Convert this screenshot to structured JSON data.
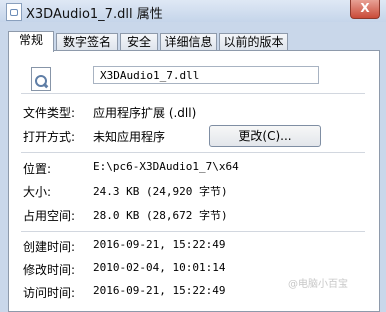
{
  "window": {
    "title": "X3DAudio1_7.dll 属性",
    "close_label": "X"
  },
  "tabs": [
    {
      "label": "常规"
    },
    {
      "label": "数字签名"
    },
    {
      "label": "安全"
    },
    {
      "label": "详细信息"
    },
    {
      "label": "以前的版本"
    }
  ],
  "file": {
    "name": "X3DAudio1_7.dll"
  },
  "props": {
    "type_label": "文件类型:",
    "type_value": "应用程序扩展 (.dll)",
    "open_label": "打开方式:",
    "open_value": "未知应用程序",
    "change_button": "更改(C)...",
    "location_label": "位置:",
    "location_value": "E:\\pc6-X3DAudio1_7\\x64",
    "size_label": "大小:",
    "size_value": "24.3 KB (24,920 字节)",
    "disk_label": "占用空间:",
    "disk_value": "28.0 KB (28,672 字节)",
    "created_label": "创建时间:",
    "created_value": "2016-09-21, 15:22:49",
    "modified_label": "修改时间:",
    "modified_value": "2010-02-04, 10:01:14",
    "accessed_label": "访问时间:",
    "accessed_value": "2016-09-21, 15:22:49"
  },
  "watermark": "@电脑小百宝"
}
